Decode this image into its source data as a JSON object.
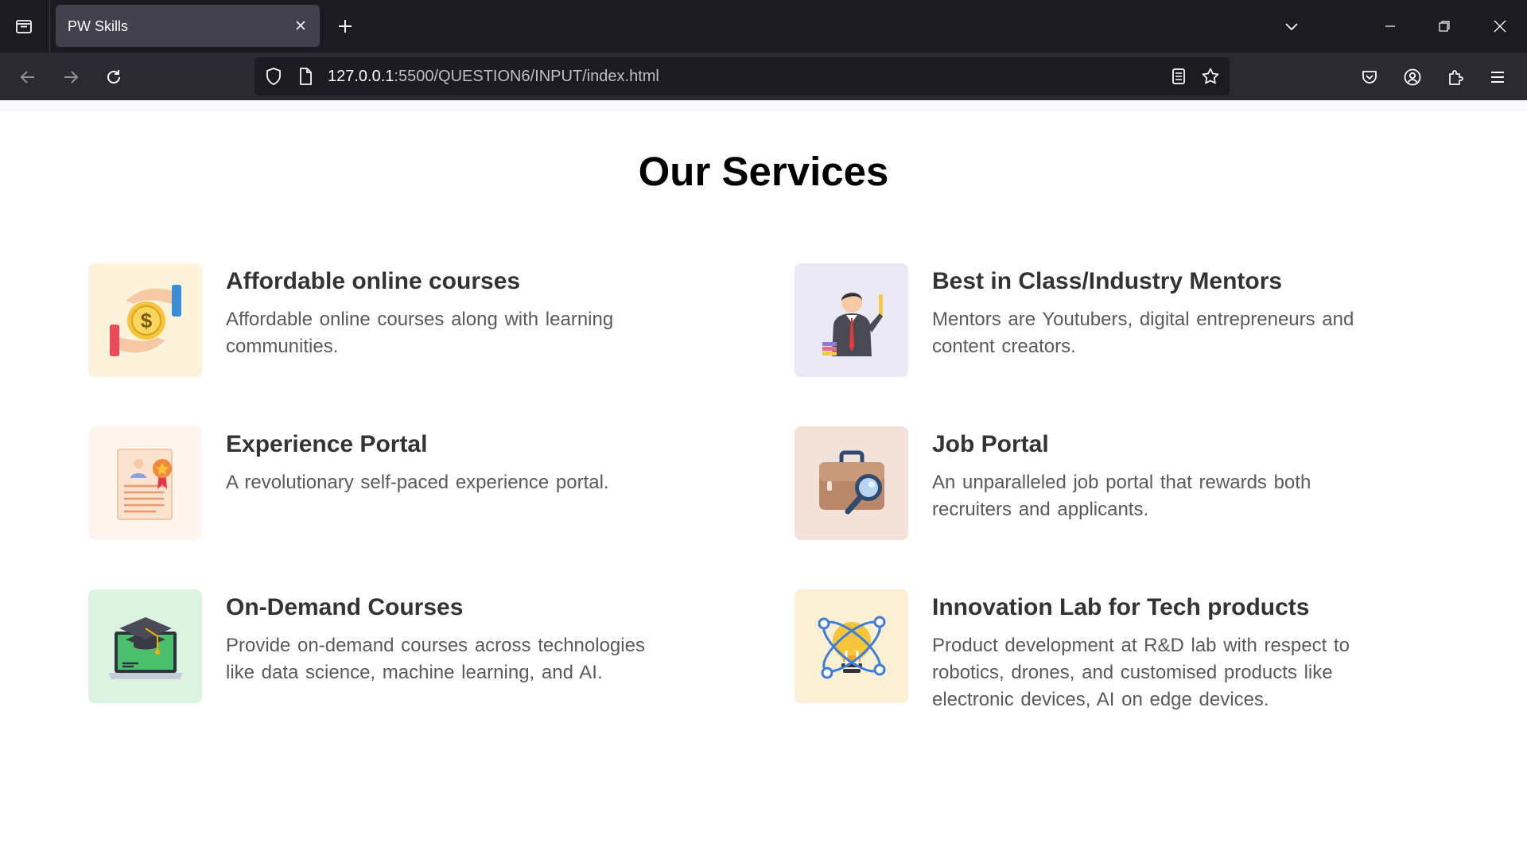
{
  "browser": {
    "tab_title": "PW Skills",
    "url_host": "127.0.0.1",
    "url_path": ":5500/QUESTION6/INPUT/index.html"
  },
  "page": {
    "title": "Our Services",
    "services": [
      {
        "title": "Affordable online courses",
        "description": "Affordable online courses along with learning communities.",
        "icon": "money-hand-icon",
        "icon_bg": "#fdf3dc"
      },
      {
        "title": "Best in Class/Industry Mentors",
        "description": "Mentors are Youtubers, digital entrepreneurs and content creators.",
        "icon": "mentor-teacher-icon",
        "icon_bg": "#ece9f7"
      },
      {
        "title": "Experience Portal",
        "description": "A revolutionary self-paced experience portal.",
        "icon": "certificate-icon",
        "icon_bg": "#fdf5ee"
      },
      {
        "title": "Job Portal",
        "description": "An unparalleled job portal that rewards both recruiters and applicants.",
        "icon": "briefcase-search-icon",
        "icon_bg": "#f3e2da"
      },
      {
        "title": "On-Demand Courses",
        "description": "Provide on-demand courses across technologies like data science, machine learning, and AI.",
        "icon": "graduation-laptop-icon",
        "icon_bg": "#dcf3e2"
      },
      {
        "title": "Innovation Lab for Tech products",
        "description": "Product development at R&D lab with respect to robotics, drones, and customised products like electronic devices, AI on edge devices.",
        "icon": "lightbulb-atom-icon",
        "icon_bg": "#fbf0d3"
      }
    ]
  }
}
